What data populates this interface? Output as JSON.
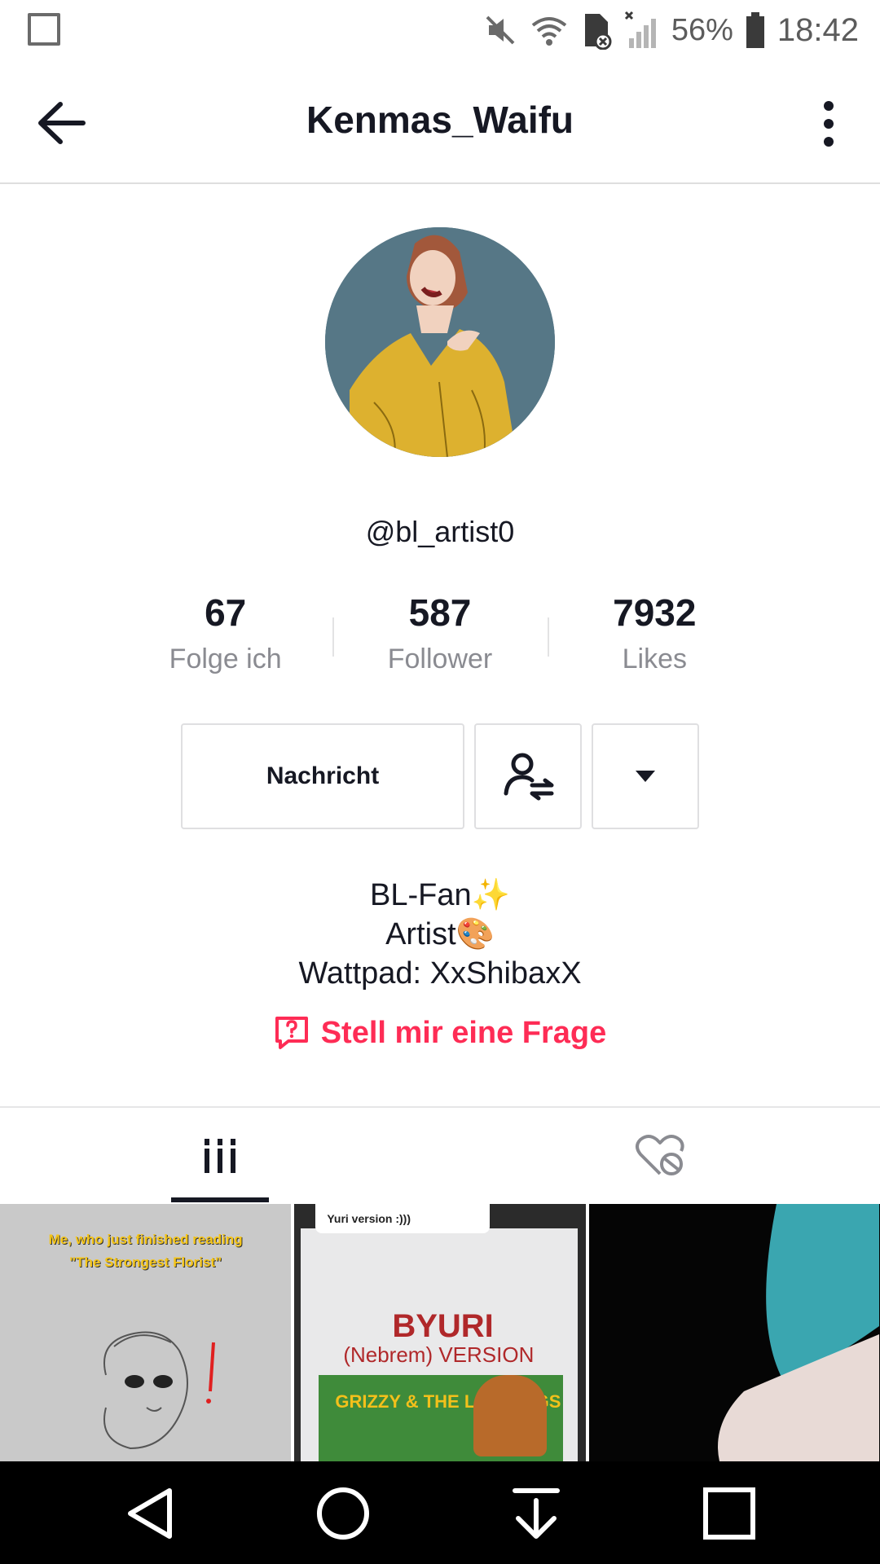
{
  "status_bar": {
    "battery_percent": "56%",
    "time": "18:42",
    "icons": [
      "gallery-icon",
      "mute-icon",
      "wifi-icon",
      "sd-card-icon",
      "signal-icon",
      "battery-icon"
    ]
  },
  "header": {
    "title": "Kenmas_Waifu",
    "back_icon": "arrow-left-icon",
    "menu_icon": "more-vertical-icon"
  },
  "profile": {
    "handle": "@bl_artist0",
    "stats": [
      {
        "value": "67",
        "label": "Folge ich"
      },
      {
        "value": "587",
        "label": "Follower"
      },
      {
        "value": "7932",
        "label": "Likes"
      }
    ]
  },
  "actions": {
    "message_label": "Nachricht",
    "follow_icon": "user-swap-icon",
    "dropdown_icon": "caret-down-icon"
  },
  "bio": {
    "line1": "BL-Fan✨",
    "line2": "Artist🎨",
    "line3": "Wattpad: XxShibaxX",
    "ask_label": "Stell mir eine Frage"
  },
  "tabs": [
    {
      "icon": "grid-icon",
      "active": true
    },
    {
      "icon": "liked-hidden-icon",
      "active": false
    }
  ],
  "videos": [
    {
      "caption_line1": "Me, who just finished reading",
      "caption_line2": "\"The Strongest Florist\""
    },
    {
      "bubble": "Yuri version :)))",
      "text1": "BYURI",
      "text2": "(Nebrem) VERSION",
      "text3": "GRIZZY & THE LEMMINGS"
    },
    {}
  ],
  "nav": [
    "back-triangle-icon",
    "home-circle-icon",
    "download-icon",
    "recents-square-icon"
  ],
  "colors": {
    "accent": "#fe2c55",
    "text": "#161823",
    "muted": "#8a8b91"
  }
}
